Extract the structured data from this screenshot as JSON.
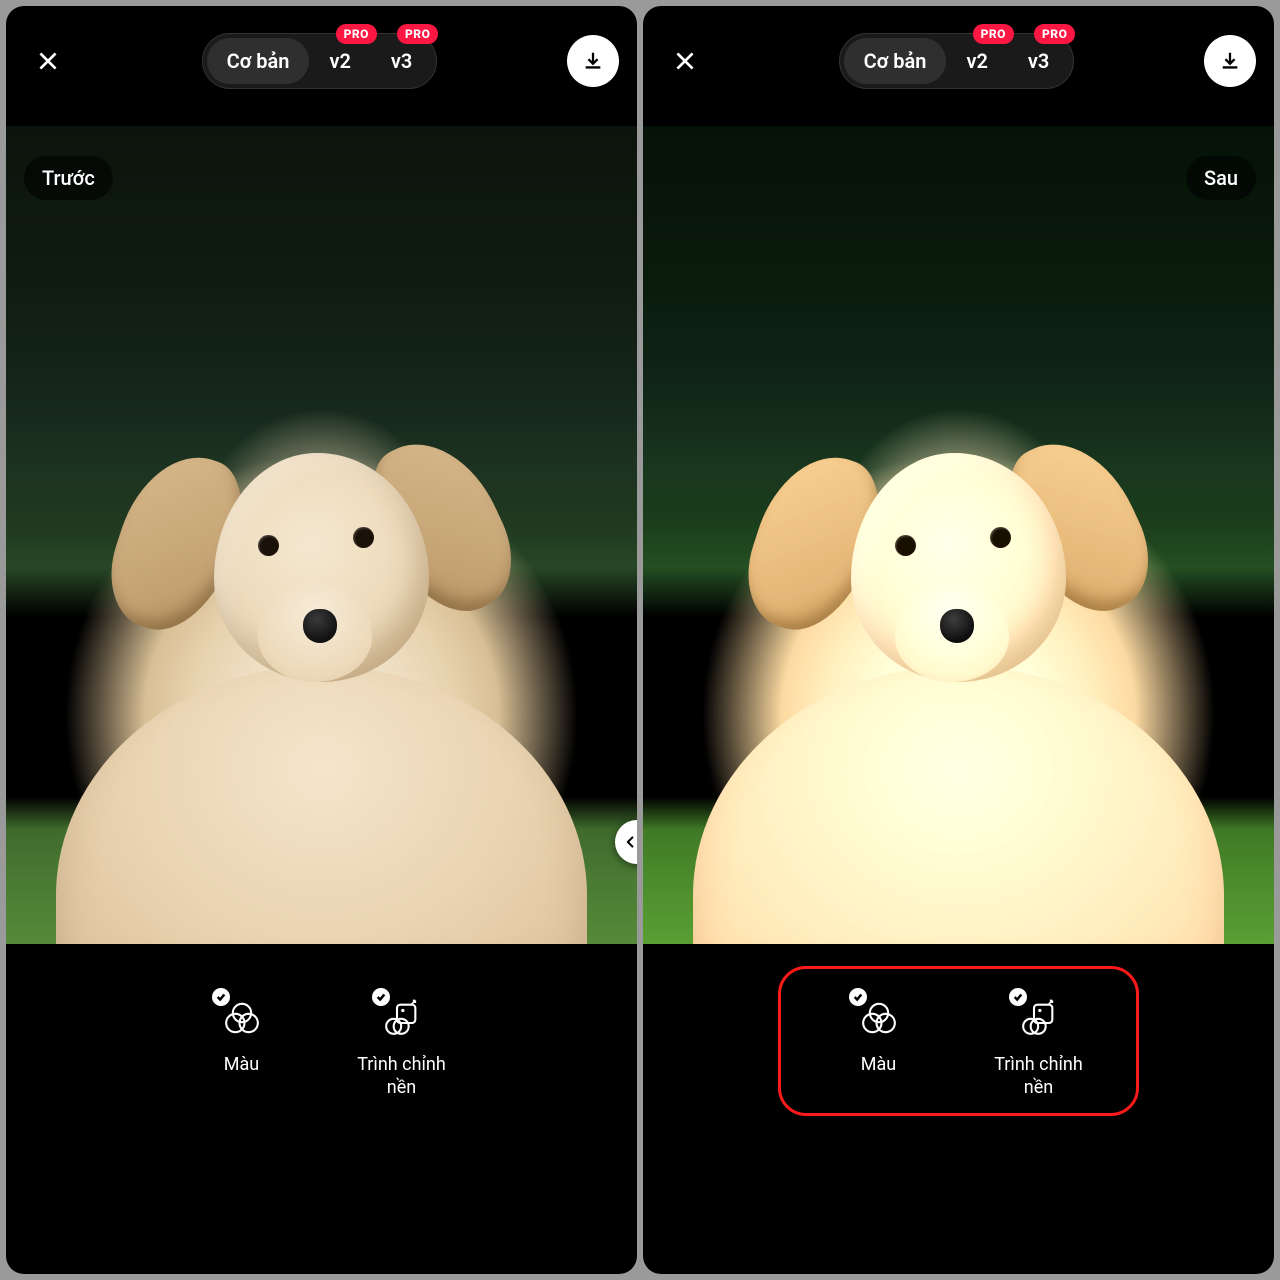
{
  "top": {
    "tabs": {
      "basic": "Cơ bản",
      "v2": "v2",
      "v3": "v3",
      "pro_badge": "PRO"
    }
  },
  "compare": {
    "before": "Trước",
    "after": "Sau"
  },
  "tools": {
    "color": "Màu",
    "bg_editor_line1": "Trình chỉnh",
    "bg_editor_line2": "nền"
  }
}
